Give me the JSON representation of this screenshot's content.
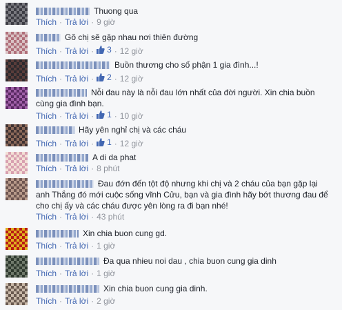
{
  "comments": [
    {
      "text": "Thuong qua",
      "actions": {
        "like": "Thích",
        "reply": "Trả lời",
        "likes": null,
        "time": "9 giờ"
      }
    },
    {
      "text": "Gõ chị sẽ gặp nhau nơi thiên đường",
      "actions": {
        "like": "Thích",
        "reply": "Trả lời",
        "likes": "3",
        "time": "12 giờ"
      }
    },
    {
      "text": "Buồn thương cho số phận 1 gia đình...!",
      "actions": {
        "like": "Thích",
        "reply": "Trả lời",
        "likes": "2",
        "time": "12 giờ"
      }
    },
    {
      "text": "Nỗi đau này là nỗi đau lớn nhất của đời người. Xin chia buồn cùng gia đình bạn.",
      "actions": {
        "like": "Thích",
        "reply": "Trả lời",
        "likes": "1",
        "time": "10 giờ"
      }
    },
    {
      "text": "Hãy yên nghỉ chị và các cháu",
      "actions": {
        "like": "Thích",
        "reply": "Trả lời",
        "likes": "1",
        "time": "12 giờ"
      }
    },
    {
      "text": "A di da phat",
      "actions": {
        "like": "Thích",
        "reply": "Trả lời",
        "likes": null,
        "time": "8 phút"
      }
    },
    {
      "text": "Đau đớn đến tột độ nhưng khi chị và 2 cháu của bạn gặp lại anh Thắng đó mới cuộc sống vĩnh Cửu, bạn và gia đình hãy bớt thương đau để cho chị ấy và các cháu được yên lòng ra đi bạn nhé!",
      "actions": {
        "like": "Thích",
        "reply": "Trả lời",
        "likes": null,
        "time": "43 phút"
      }
    },
    {
      "text": "Xin chia buon cung gd.",
      "actions": {
        "like": "Thích",
        "reply": "Trả lời",
        "likes": null,
        "time": "1 giờ"
      }
    },
    {
      "text": "Đa qua nhieu noi dau , chia buon cung gia dinh",
      "actions": {
        "like": "Thích",
        "reply": "Trả lời",
        "likes": null,
        "time": "1 giờ"
      }
    },
    {
      "text": "Xin chia buon cung gia dinh.",
      "actions": {
        "like": "Thích",
        "reply": "Trả lời",
        "likes": null,
        "time": "2 giờ"
      }
    }
  ],
  "colors": {
    "link": "#4267b2",
    "meta": "#90949c",
    "text": "#1d2129",
    "background": "#f6f7f9"
  },
  "icons": {
    "like": "thumbs-up-icon",
    "avatar": "pixelated-avatar"
  }
}
